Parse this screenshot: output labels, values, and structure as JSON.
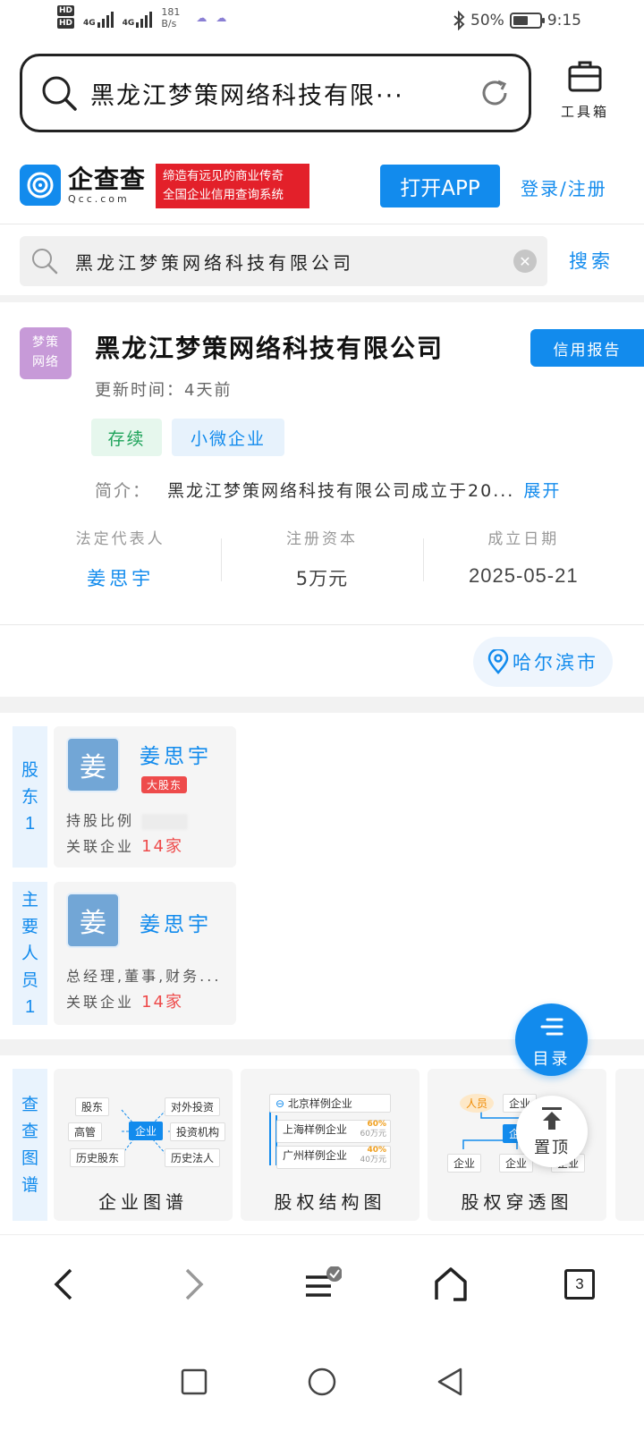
{
  "status_bar": {
    "hd1": "HD",
    "hd2": "HD",
    "net1": "4G",
    "net2": "4G",
    "speed_value": "181",
    "speed_unit": "B/s",
    "battery": "50%",
    "time": "9:15"
  },
  "browser": {
    "url_text": "黑龙江梦策网络科技有限···",
    "toolbox_label": "工具箱"
  },
  "qcc": {
    "logo_cn": "企查查",
    "logo_en": "Qcc.com",
    "slogan_line1": "缔造有远见的商业传奇",
    "slogan_line2": "全国企业信用查询系统",
    "open_app": "打开APP",
    "login": "登录/注册",
    "search_value": "黑龙江梦策网络科技有限公司",
    "search_button": "搜索"
  },
  "company": {
    "logo_line1": "梦策",
    "logo_line2": "网络",
    "name": "黑龙江梦策网络科技有限公司",
    "credit_report": "信用报告",
    "update_time": "更新时间：4天前",
    "tag_status": "存续",
    "tag_type": "小微企业",
    "intro_label": "简介：",
    "intro_text": "黑龙江梦策网络科技有限公司成立于20...",
    "intro_more": "展开",
    "stats": [
      {
        "label": "法定代表人",
        "value": "姜思宇"
      },
      {
        "label": "注册资本",
        "value": "5万元"
      },
      {
        "label": "成立日期",
        "value": "2025-05-21"
      }
    ],
    "city": "哈尔滨市"
  },
  "shareholders": {
    "side_label_chars": [
      "股",
      "东"
    ],
    "count": "1",
    "avatar": "姜",
    "name": "姜思宇",
    "badge": "大股东",
    "ratio_label": "持股比例",
    "related_label": "关联企业",
    "related_count": "14",
    "related_unit": "家"
  },
  "staff": {
    "side_label_chars": [
      "主",
      "要",
      "人",
      "员"
    ],
    "count": "1",
    "avatar": "姜",
    "name": "姜思宇",
    "roles": "总经理,董事,财务...",
    "related_label": "关联企业",
    "related_count": "14",
    "related_unit": "家"
  },
  "toc_button": "目录",
  "top_button": "置顶",
  "graphs": {
    "side_label_chars": [
      "查",
      "查",
      "图",
      "谱"
    ],
    "cards": [
      {
        "title": "企业图谱",
        "nodes": [
          "股东",
          "对外投资",
          "高管",
          "企业",
          "投资机构",
          "历史股东",
          "历史法人"
        ]
      },
      {
        "title": "股权结构图",
        "rows": [
          "北京样例企业",
          "上海样例企业",
          "广州样例企业"
        ],
        "pct1": "60%",
        "amt1": "60万元",
        "pct2": "40%",
        "amt2": "40万元"
      },
      {
        "title": "股权穿透图",
        "nodes": [
          "人员",
          "企业",
          "企",
          "企业",
          "企业",
          "企业"
        ]
      }
    ]
  },
  "bottom_nav": {
    "tabs_count": "3"
  },
  "colors": {
    "brand_blue": "#128bed",
    "alert_red": "#ee4b4b",
    "tag_green": "#1ea35a"
  }
}
